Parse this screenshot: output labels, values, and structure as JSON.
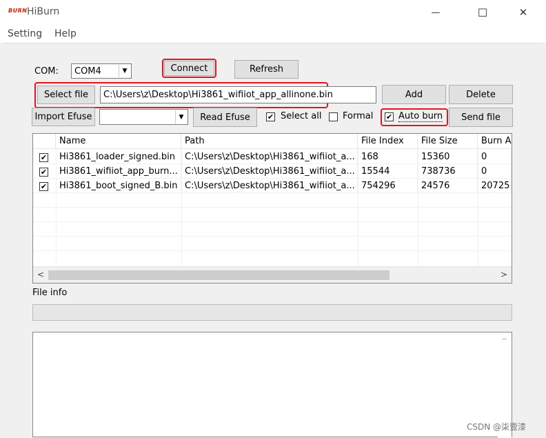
{
  "window": {
    "logo_text": "BURN",
    "title": "HiBurn",
    "minimize_glyph": "—",
    "maximize_glyph": "☐",
    "close_glyph": "✕"
  },
  "menu": {
    "items": [
      "Setting",
      "Help"
    ]
  },
  "com": {
    "label": "COM:",
    "value": "COM4",
    "connect_label": "Connect",
    "refresh_label": "Refresh"
  },
  "file": {
    "select_label": "Select file",
    "path": "C:\\Users\\z\\Desktop\\Hi3861_wifiiot_app_allinone.bin",
    "add_label": "Add",
    "delete_label": "Delete"
  },
  "efuse": {
    "import_label": "Import Efuse",
    "dropdown_value": "",
    "read_label": "Read Efuse",
    "select_all_label": "Select all",
    "select_all_checked": true,
    "formal_label": "Formal",
    "formal_checked": false,
    "auto_burn_label": "Auto burn",
    "auto_burn_checked": true,
    "send_file_label": "Send file"
  },
  "table": {
    "columns": [
      "Name",
      "Path",
      "File Index",
      "File Size",
      "Burn A"
    ],
    "rows": [
      {
        "checked": true,
        "name": "Hi3861_loader_signed.bin",
        "path": "C:\\Users\\z\\Desktop\\Hi3861_wifiiot_a...",
        "file_index": "168",
        "file_size": "15360",
        "burn_addr": "0"
      },
      {
        "checked": true,
        "name": "Hi3861_wifiiot_app_burn...",
        "path": "C:\\Users\\z\\Desktop\\Hi3861_wifiiot_a...",
        "file_index": "15544",
        "file_size": "738736",
        "burn_addr": "0"
      },
      {
        "checked": true,
        "name": "Hi3861_boot_signed_B.bin",
        "path": "C:\\Users\\z\\Desktop\\Hi3861_wifiiot_a...",
        "file_index": "754296",
        "file_size": "24576",
        "burn_addr": "20725"
      }
    ],
    "scroll_left_glyph": "<",
    "scroll_right_glyph": ">"
  },
  "file_info": {
    "label": "File info"
  },
  "log": {
    "scroll_up_glyph": "^"
  },
  "check_glyph": "✔",
  "dropdown_glyph": "▼",
  "watermark": "CSDN @柒壹漆",
  "colors": {
    "highlight": "#e8131a",
    "brand": "#d81e06"
  }
}
